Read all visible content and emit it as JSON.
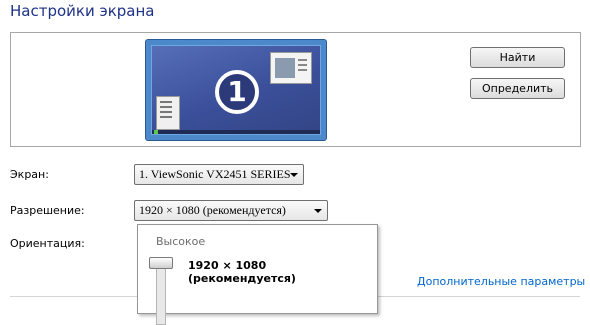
{
  "page": {
    "title": "Настройки экрана"
  },
  "preview": {
    "monitor_number": "1"
  },
  "buttons": {
    "find": "Найти",
    "identify": "Определить"
  },
  "fields": {
    "screen": {
      "label": "Экран:",
      "value": "1. ViewSonic VX2451 SERIES"
    },
    "resolution": {
      "label": "Разрешение:",
      "value": "1920 × 1080 (рекомендуется)"
    },
    "orientation": {
      "label": "Ориентация:"
    }
  },
  "resolution_dropdown": {
    "high_label": "Высокое",
    "current": "1920 × 1080 (рекомендуется)"
  },
  "links": {
    "advanced": "Дополнительные параметры"
  },
  "colors": {
    "title": "#1e3287",
    "link": "#0066cc",
    "monitor_bg": "#4c89cb"
  }
}
